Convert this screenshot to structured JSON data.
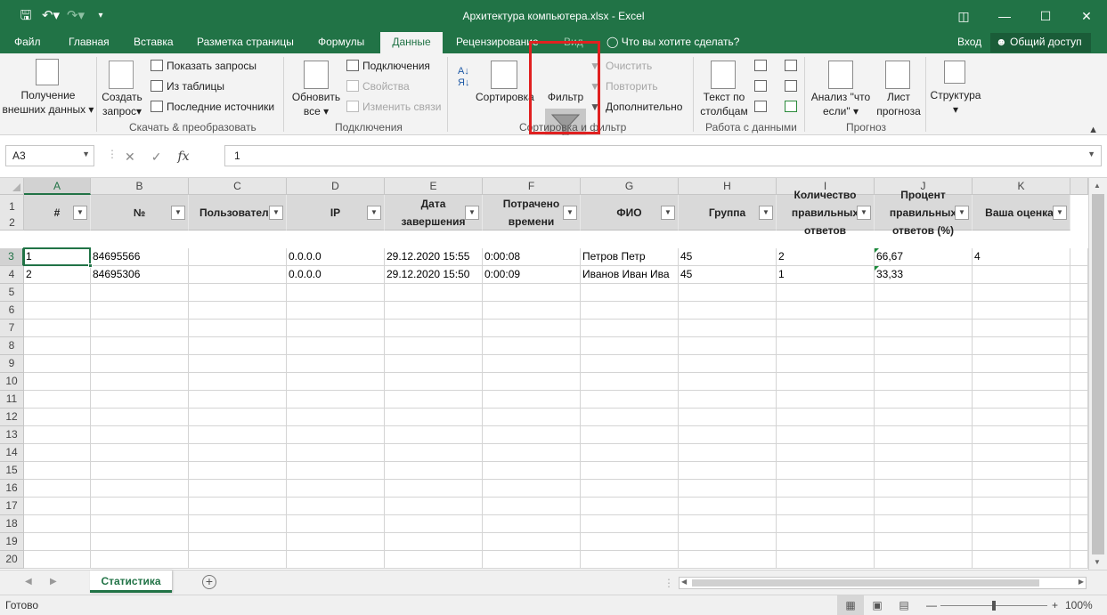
{
  "window": {
    "title": "Архитектура компьютера.xlsx - Excel"
  },
  "qat_icons": [
    "save-icon",
    "undo-icon",
    "redo-icon",
    "customize-qat-icon"
  ],
  "ribbon_tabs": [
    "Файл",
    "Главная",
    "Вставка",
    "Разметка страницы",
    "Формулы",
    "Данные",
    "Рецензирование",
    "Вид"
  ],
  "active_tab": "Данные",
  "tell_me": "Что вы хотите сделать?",
  "login": "Вход",
  "share": "Общий доступ",
  "ribbon": {
    "get_external": [
      "Получение",
      "внешних данных"
    ],
    "create_query": [
      "Создать",
      "запрос"
    ],
    "show_queries": "Показать запросы",
    "from_table": "Из таблицы",
    "recent_sources": "Последние источники",
    "group1": "Скачать & преобразовать",
    "refresh_all": [
      "Обновить",
      "все"
    ],
    "connections": "Подключения",
    "properties": "Свойства",
    "edit_links": "Изменить связи",
    "group2": "Подключения",
    "sort": "Сортировка",
    "filter": "Фильтр",
    "clear": "Очистить",
    "reapply": "Повторить",
    "advanced": "Дополнительно",
    "group3": "Сортировка и фильтр",
    "text_to_columns": [
      "Текст по",
      "столбцам"
    ],
    "group4": "Работа с данными",
    "what_if": [
      "Анализ \"что",
      "если\""
    ],
    "forecast_sheet": [
      "Лист",
      "прогноза"
    ],
    "group5": "Прогноз",
    "outline": "Структура"
  },
  "formula_bar": {
    "name_box": "A3",
    "fx": "fx",
    "value": "1"
  },
  "columns": [
    "A",
    "B",
    "C",
    "D",
    "E",
    "F",
    "G",
    "H",
    "I",
    "J",
    "K"
  ],
  "rows": [
    "1",
    "2",
    "3",
    "4",
    "5",
    "6",
    "7",
    "8",
    "9",
    "10",
    "11",
    "12",
    "13",
    "14",
    "15",
    "16",
    "17",
    "18",
    "19",
    "20"
  ],
  "headers": [
    [
      "#"
    ],
    [
      "№"
    ],
    [
      "Пользователь"
    ],
    [
      "IP"
    ],
    [
      "Дата",
      "завершения"
    ],
    [
      "Потрачено",
      "времени"
    ],
    [
      "ФИО"
    ],
    [
      "Группа"
    ],
    [
      "Количество",
      "правильных",
      "ответов"
    ],
    [
      "Процент",
      "правильных",
      "ответов (%)"
    ],
    [
      "Ваша оценка:"
    ]
  ],
  "data_rows": [
    [
      "1",
      "84695566",
      "",
      "0.0.0.0",
      "29.12.2020 15:55",
      "0:00:08",
      "Петров Петр",
      "45",
      "2",
      "66,67",
      "4"
    ],
    [
      "2",
      "84695306",
      "",
      "0.0.0.0",
      "29.12.2020 15:50",
      "0:00:09",
      "Иванов Иван Ива",
      "45",
      "1",
      "33,33",
      ""
    ]
  ],
  "sheet_tab": "Статистика",
  "status": "Готово",
  "zoom": "100%"
}
